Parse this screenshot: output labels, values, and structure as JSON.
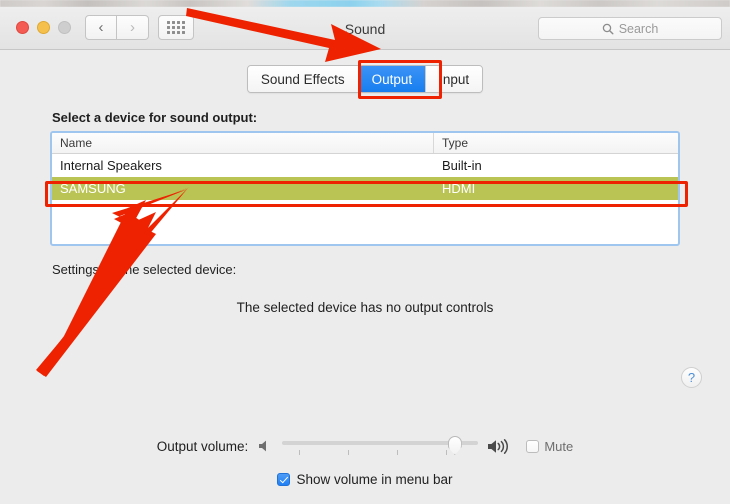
{
  "window": {
    "title": "Sound",
    "traffic_lights": [
      "close",
      "minimize",
      "zoom-disabled"
    ],
    "back_glyph": "‹",
    "forward_glyph": "›",
    "grid_icon": "show-all-icon"
  },
  "search": {
    "placeholder": "Search",
    "icon": "search-icon"
  },
  "tabs": [
    {
      "label": "Sound Effects",
      "active": false
    },
    {
      "label": "Output",
      "active": true
    },
    {
      "label": "Input",
      "active": false
    }
  ],
  "main": {
    "section_label": "Select a device for sound output:",
    "table": {
      "columns": [
        "Name",
        "Type"
      ],
      "rows": [
        {
          "name": "Internal Speakers",
          "type": "Built-in",
          "selected": false
        },
        {
          "name": "SAMSUNG",
          "type": "HDMI",
          "selected": true
        }
      ]
    },
    "settings_label": "Settings for the selected device:",
    "no_controls_text": "The selected device has no output controls",
    "help_glyph": "?"
  },
  "volume": {
    "label": "Output volume:",
    "min_icon": "speaker-low-icon",
    "max_icon": "speaker-high-icon",
    "value_percent": 88,
    "tick_count": 4,
    "mute_label": "Mute",
    "mute_checked": false
  },
  "menubar_option": {
    "label": "Show volume in menu bar",
    "checked": true
  },
  "annotations": {
    "box_output_tab": "red-highlight-box",
    "box_selected_row": "red-highlight-box",
    "arrow_to_tab": "red-arrow-right",
    "arrow_to_row": "red-arrow-up-right",
    "color": "#ee2200"
  },
  "colors": {
    "accent_blue": "#177ef0",
    "selection_olive": "#b9c455",
    "annotation_red": "#ee2200",
    "window_bg": "#ececec"
  }
}
